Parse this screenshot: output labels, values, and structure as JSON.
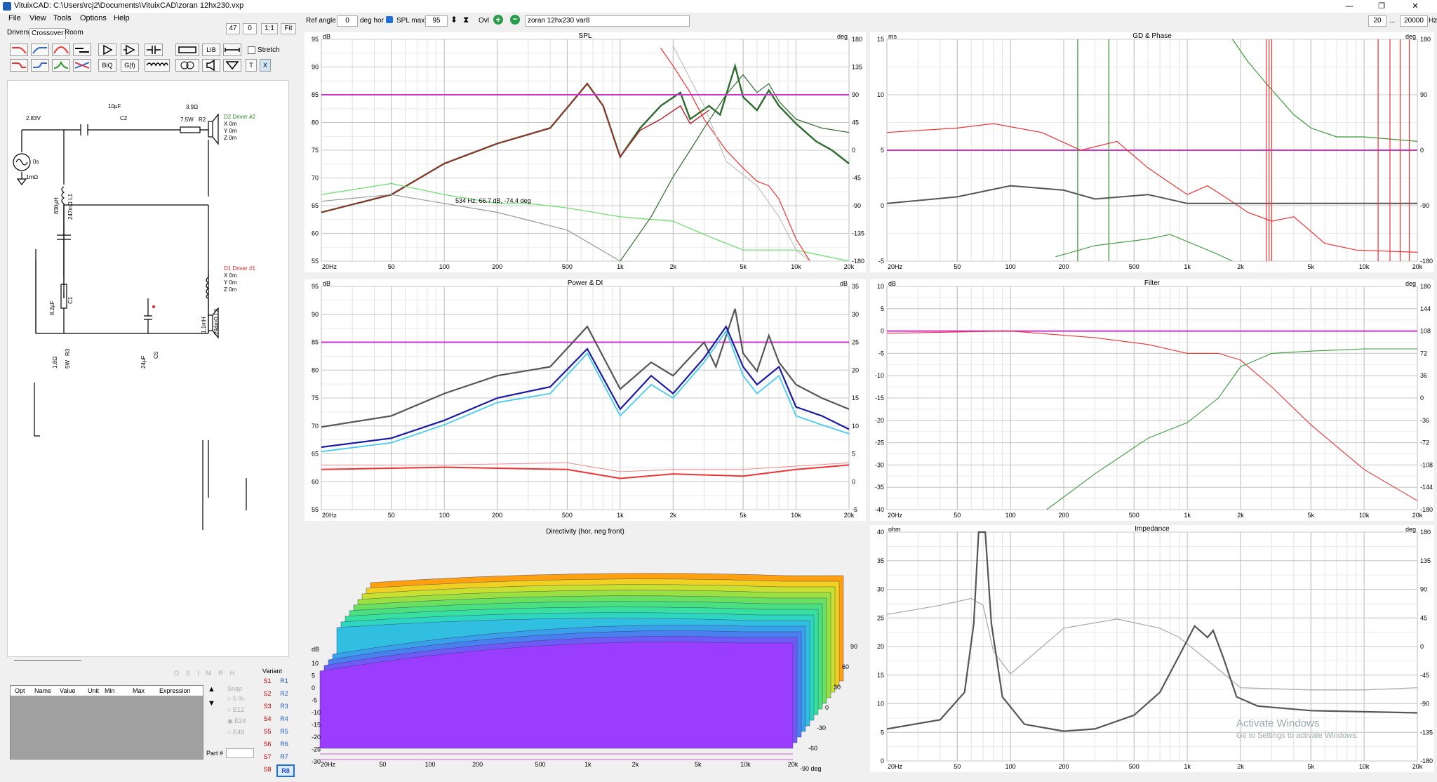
{
  "window": {
    "title": "VituixCAD: C:\\Users\\rcj2\\Documents\\VituixCAD\\zoran 12hx230.vxp",
    "controls": [
      "—",
      "❐",
      "✕"
    ]
  },
  "menu": [
    "File",
    "View",
    "Tools",
    "Options",
    "Help"
  ],
  "toolbar": {
    "field1": "47",
    "field2": "0",
    "btn_1to1": "1:1",
    "btn_fit": "Fit",
    "ref_angle_label": "Ref angle",
    "ref_angle_value": "0",
    "deg_hor_label": "deg hor",
    "spl_max_label": "SPL max",
    "spl_max_value": "95",
    "ovl_label": "Ovl",
    "overlay_name": "zoran 12hx230 var8",
    "freq_min": "20",
    "freq_ellipsis": "...",
    "freq_max": "20000",
    "freq_unit": "Hz"
  },
  "tabs": [
    "Drivers",
    "Crossover",
    "Room"
  ],
  "stretch_label": "Stretch",
  "tool_labels": {
    "lib": "LIB",
    "biq": "BiQ",
    "gf": "G(f)",
    "t": "T",
    "x": "X"
  },
  "schematic": {
    "labels": [
      "2.83V",
      "0s",
      "1mΩ",
      "10µF",
      "C2",
      "3.9Ω",
      "7.5W",
      "R2",
      "830µH",
      "247mΩ L1",
      "8.2µF",
      "C1",
      "1.1mH",
      "294mΩ L3",
      "1.8Ω",
      "5W",
      "R3",
      "24µF",
      "C5"
    ],
    "driver2": {
      "name": "D2 Driver #2",
      "x": "X 0m",
      "y": "Y 0m",
      "z": "Z 0m"
    },
    "driver1": {
      "name": "D1 Driver #1",
      "x": "X 0m",
      "y": "Y 0m",
      "z": "Z 0m"
    }
  },
  "parts_table": {
    "headers": [
      "Opt",
      "Name",
      "Value",
      "Unit",
      "Min",
      "Max",
      "Expression"
    ],
    "top_buttons": [
      "O",
      "S",
      "I",
      "M",
      "R",
      "H"
    ],
    "snap_label": "Snap",
    "snap_options": [
      "5 %",
      "E12",
      "E24",
      "E48"
    ],
    "part_label": "Part #"
  },
  "variant": {
    "label": "Variant",
    "s": [
      "S1",
      "S2",
      "S3",
      "S4",
      "S5",
      "S6",
      "S7",
      "S8"
    ],
    "r": [
      "R1",
      "R2",
      "R3",
      "R4",
      "R5",
      "R6",
      "R7",
      "R8"
    ],
    "active": "R8"
  },
  "freq_ticks": [
    "20Hz",
    "50",
    "100",
    "200",
    "500",
    "1k",
    "2k",
    "5k",
    "10k",
    "20k"
  ],
  "charts": {
    "spl": {
      "title": "SPL",
      "left_unit": "dB",
      "right_unit": "deg",
      "left_ticks": [
        "95",
        "90",
        "85",
        "80",
        "75",
        "70",
        "65",
        "60",
        "55"
      ],
      "right_ticks": [
        "180",
        "135",
        "90",
        "45",
        "0",
        "-45",
        "-90",
        "-135",
        "-180"
      ],
      "annotation": "534 Hz, 66.7 dB, -74.4 deg"
    },
    "gd": {
      "title": "GD & Phase",
      "left_unit": "ms",
      "right_unit": "deg",
      "left_ticks": [
        "15",
        "10",
        "5",
        "0",
        "-5"
      ],
      "right_ticks": [
        "180",
        "90",
        "0",
        "-90",
        "-180"
      ]
    },
    "power": {
      "title": "Power & DI",
      "left_unit": "dB",
      "right_unit": "dB",
      "left_ticks": [
        "95",
        "90",
        "85",
        "80",
        "75",
        "70",
        "65",
        "60",
        "55"
      ],
      "right_ticks": [
        "35",
        "30",
        "25",
        "20",
        "15",
        "10",
        "5",
        "0",
        "-5"
      ]
    },
    "filter": {
      "title": "Filter",
      "left_unit": "dB",
      "right_unit": "deg",
      "left_ticks": [
        "10",
        "5",
        "0",
        "-5",
        "-10",
        "-15",
        "-20",
        "-25",
        "-30",
        "-35",
        "-40"
      ],
      "right_ticks": [
        "180",
        "144",
        "108",
        "72",
        "36",
        "0",
        "-36",
        "-72",
        "-108",
        "-144",
        "-180"
      ]
    },
    "directivity": {
      "title": "Directivity (hor, neg front)",
      "left_unit": "dB",
      "left_ticks": [
        "10",
        "5",
        "0",
        "-5",
        "-10",
        "-15",
        "-20",
        "-25",
        "-30"
      ],
      "angle_ticks": [
        "90",
        "60",
        "30",
        "0",
        "-30",
        "-60",
        "-90 deg"
      ]
    },
    "impedance": {
      "title": "Impedance",
      "left_unit": "ohm",
      "right_unit": "deg",
      "left_ticks": [
        "40",
        "35",
        "30",
        "25",
        "20",
        "15",
        "10",
        "5",
        "0"
      ],
      "right_ticks": [
        "180",
        "135",
        "90",
        "45",
        "0",
        "-45",
        "-90",
        "-135",
        "-180"
      ]
    }
  },
  "watermark": {
    "line1": "Activate Windows",
    "line2": "Go to Settings to activate Windows."
  },
  "colors": {
    "ref_line": "#cc33cc",
    "green_dark": "#2e6b2e",
    "green_light": "#66dd66",
    "red": "#ee3333",
    "grey": "#999999",
    "blue": "#1a1aa8",
    "cyan": "#44ccee"
  }
}
